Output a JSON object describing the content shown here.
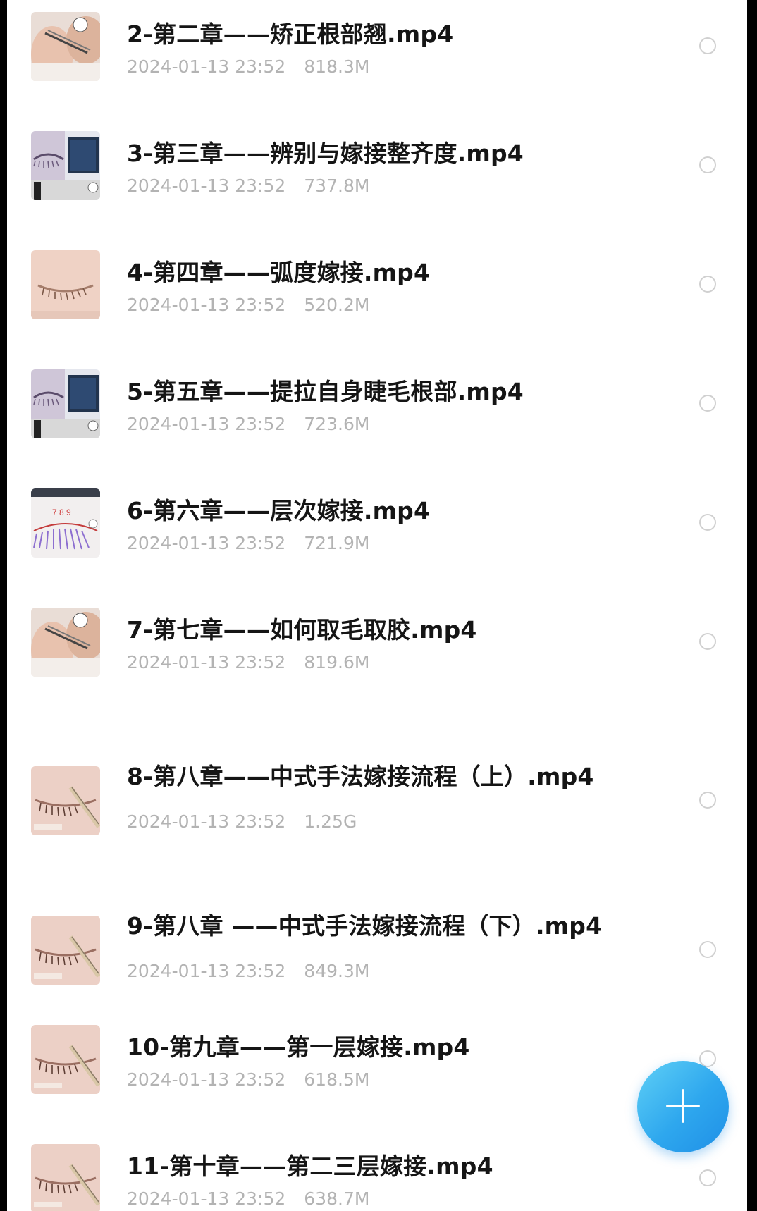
{
  "files": [
    {
      "name": "2-第二章——矫正根部翘.mp4",
      "date": "2024-01-13 23:52",
      "size": "818.3M",
      "thumb": "hands-tweezers"
    },
    {
      "name": "3-第三章——辨别与嫁接整齐度.mp4",
      "date": "2024-01-13 23:52",
      "size": "737.8M",
      "thumb": "eye-monitor"
    },
    {
      "name": "4-第四章——弧度嫁接.mp4",
      "date": "2024-01-13 23:52",
      "size": "520.2M",
      "thumb": "closed-eye"
    },
    {
      "name": "5-第五章——提拉自身睫毛根部.mp4",
      "date": "2024-01-13 23:52",
      "size": "723.6M",
      "thumb": "eye-monitor"
    },
    {
      "name": "6-第六章——层次嫁接.mp4",
      "date": "2024-01-13 23:52",
      "size": "721.9M",
      "thumb": "lash-diagram"
    },
    {
      "name": "7-第七章——如何取毛取胶.mp4",
      "date": "2024-01-13 23:52",
      "size": "819.6M",
      "thumb": "hands-tweezers"
    },
    {
      "name": "8-第八章——中式手法嫁接流程（上）.mp4",
      "date": "2024-01-13 23:52",
      "size": "1.25G",
      "thumb": "eye-tool"
    },
    {
      "name": "9-第八章 ——中式手法嫁接流程（下）.mp4",
      "date": "2024-01-13 23:52",
      "size": "849.3M",
      "thumb": "eye-tool"
    },
    {
      "name": "10-第九章——第一层嫁接.mp4",
      "date": "2024-01-13 23:52",
      "size": "618.5M",
      "thumb": "eye-tool"
    },
    {
      "name": "11-第十章——第二三层嫁接.mp4",
      "date": "2024-01-13 23:52",
      "size": "638.7M",
      "thumb": "eye-tool"
    }
  ],
  "fab": {
    "label": "+",
    "icon": "plus-icon",
    "color": "#2ea7ee"
  }
}
